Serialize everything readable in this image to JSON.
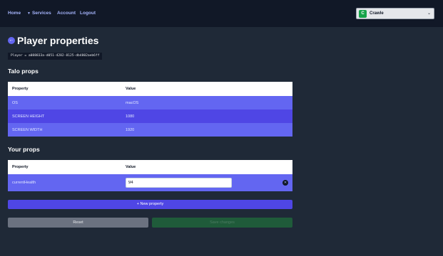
{
  "nav": {
    "home": "Home",
    "services": "Services",
    "account": "Account",
    "logout": "Logout"
  },
  "game": {
    "initial": "C",
    "name": "Crawle"
  },
  "page": {
    "title": "Player properties",
    "player_id": "Player = a088833a-d051-4282-8125-db4802aeb6ff"
  },
  "talo_props": {
    "heading": "Talo props",
    "headers": {
      "property": "Property",
      "value": "Value"
    },
    "rows": [
      {
        "property": "OS",
        "value": "macOS"
      },
      {
        "property": "SCREEN HEIGHT",
        "value": "1080"
      },
      {
        "property": "SCREEN WIDTH",
        "value": "1920"
      }
    ]
  },
  "your_props": {
    "heading": "Your props",
    "headers": {
      "property": "Property",
      "value": "Value"
    },
    "rows": [
      {
        "property": "currentHealth",
        "value": "94"
      }
    ]
  },
  "actions": {
    "new_property": "+ New property",
    "reset": "Reset",
    "save": "Save changes"
  },
  "colors": {
    "accent": "#6366f1",
    "row_a": "#6366f1",
    "row_b": "#4f46e5",
    "save_disabled": "#1f5b3a"
  }
}
